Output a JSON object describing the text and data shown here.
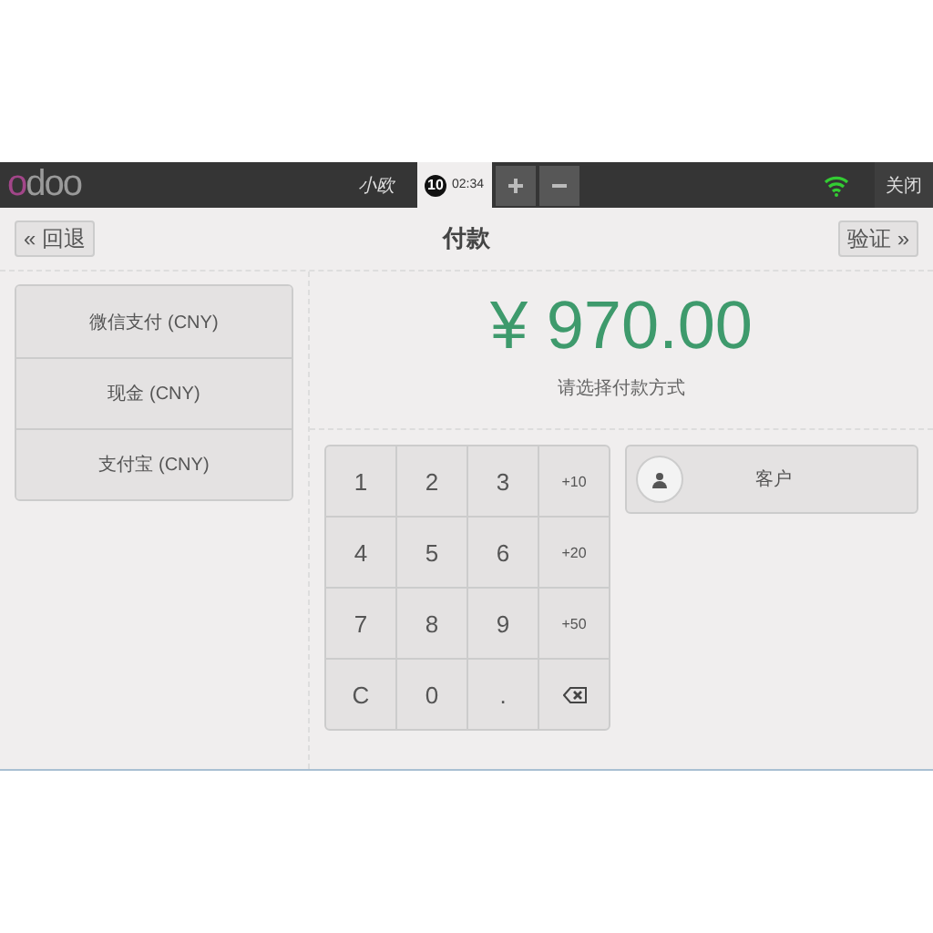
{
  "topbar": {
    "logo": "odoo",
    "user": "小欧",
    "order": {
      "number": "10",
      "time": "02:34",
      "selected": true
    },
    "close": "关闭"
  },
  "header": {
    "back": "« 回退",
    "title": "付款",
    "validate": "验证 »"
  },
  "payment_methods": [
    "微信支付 (CNY)",
    "现金 (CNY)",
    "支付宝 (CNY)"
  ],
  "amount": "¥ 970.00",
  "hint": "请选择付款方式",
  "keypad": [
    {
      "kind": "digit",
      "label": "1"
    },
    {
      "kind": "digit",
      "label": "2"
    },
    {
      "kind": "digit",
      "label": "3"
    },
    {
      "kind": "add",
      "label": "+10"
    },
    {
      "kind": "digit",
      "label": "4"
    },
    {
      "kind": "digit",
      "label": "5"
    },
    {
      "kind": "digit",
      "label": "6"
    },
    {
      "kind": "add",
      "label": "+20"
    },
    {
      "kind": "digit",
      "label": "7"
    },
    {
      "kind": "digit",
      "label": "8"
    },
    {
      "kind": "digit",
      "label": "9"
    },
    {
      "kind": "add",
      "label": "+50"
    },
    {
      "kind": "digit",
      "label": "C"
    },
    {
      "kind": "digit",
      "label": "0"
    },
    {
      "kind": "digit",
      "label": "."
    },
    {
      "kind": "backspace"
    }
  ],
  "customer": "客户"
}
